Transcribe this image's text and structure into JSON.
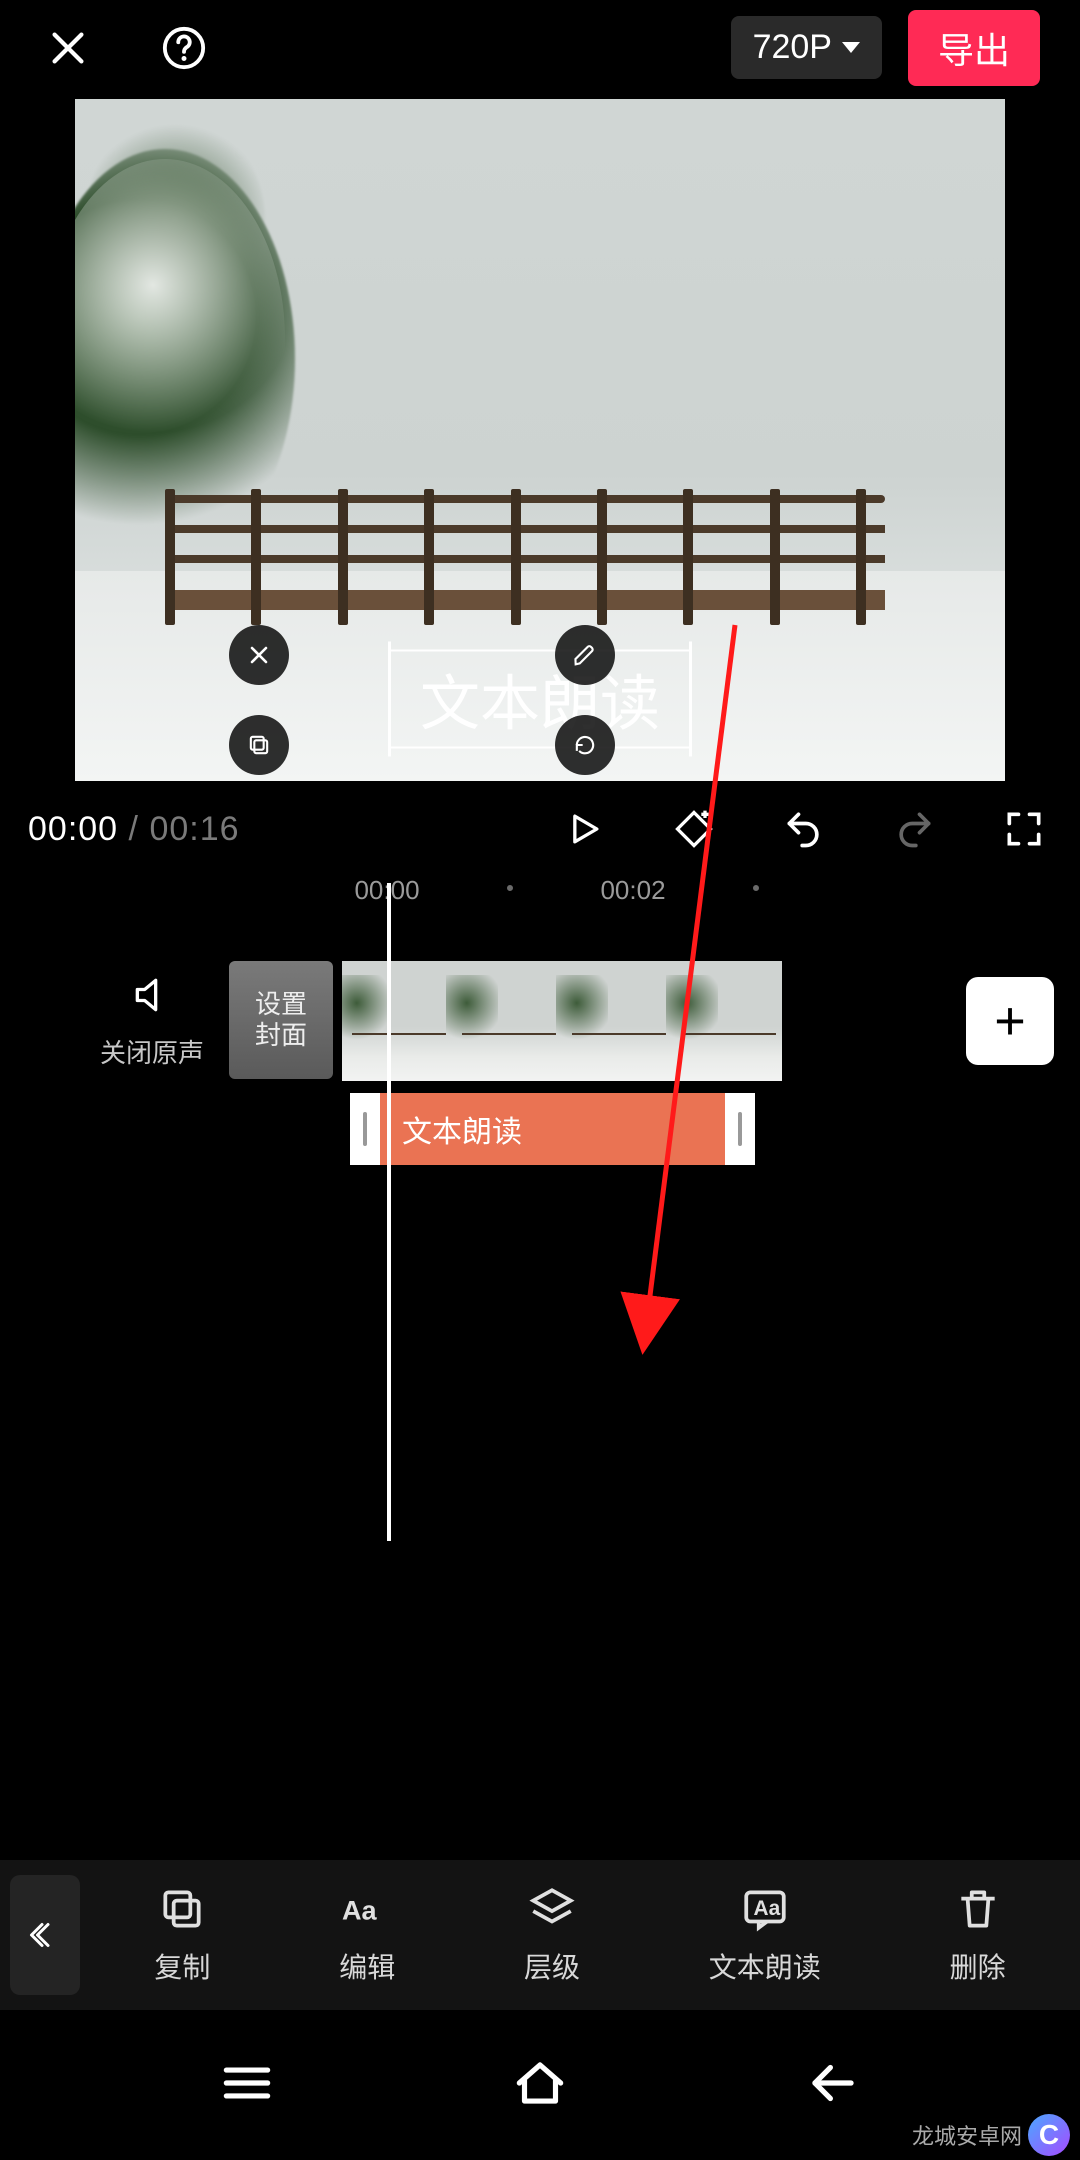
{
  "top": {
    "resolution": "720P",
    "export": "导出"
  },
  "preview": {
    "text_overlay": "文本朗读"
  },
  "playback": {
    "current": "00:00",
    "separator": " / ",
    "duration": "00:16"
  },
  "timeline": {
    "ticks": [
      "00:00",
      "00:02"
    ],
    "mute_label": "关闭原声",
    "cover_label": "设置\n封面",
    "text_track_label": "文本朗读",
    "add_symbol": "+"
  },
  "tools": {
    "copy": "复制",
    "edit": "编辑",
    "layer": "层级",
    "tts": "文本朗读",
    "delete": "删除"
  },
  "watermark": {
    "site": "龙城安卓网",
    "badge": "C"
  }
}
